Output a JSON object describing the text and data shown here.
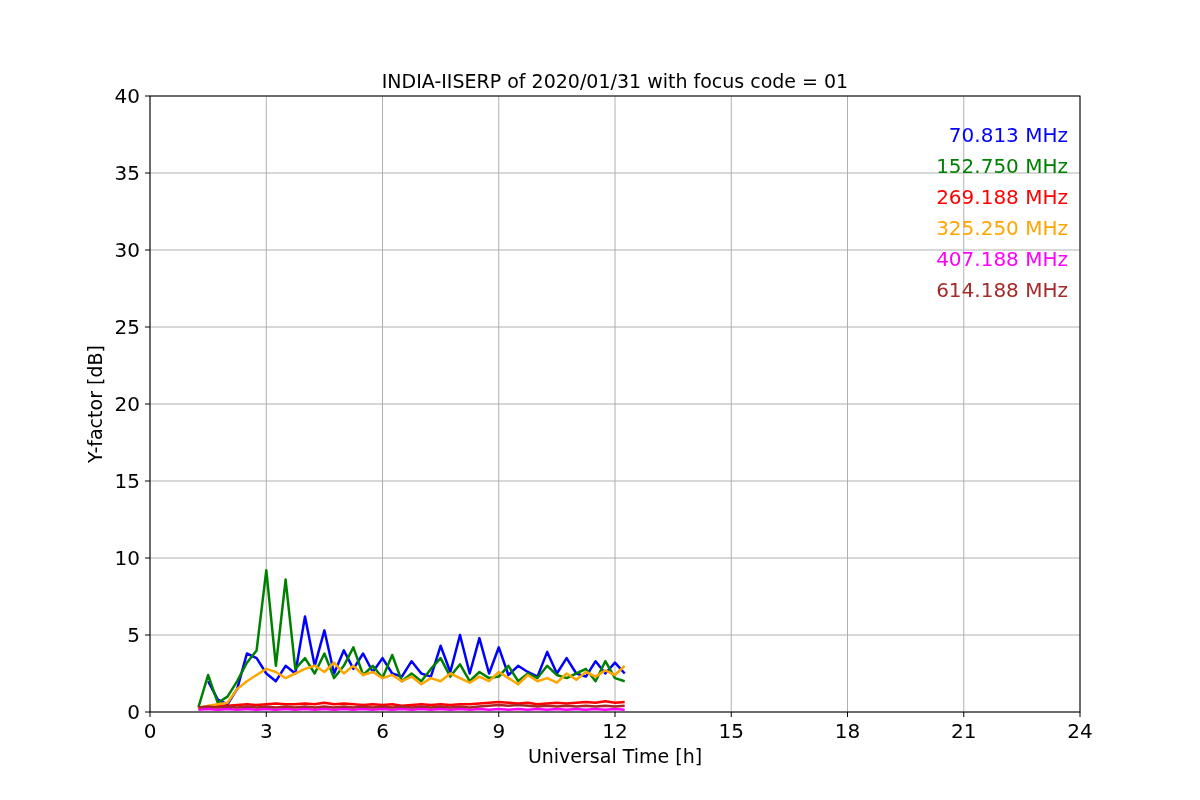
{
  "chart_data": {
    "type": "line",
    "title": "INDIA-IISERP of 2020/01/31 with focus code = 01",
    "xlabel": "Universal Time [h]",
    "ylabel": "Y-factor [dB]",
    "x": [
      1.25,
      1.5,
      1.75,
      2,
      2.25,
      2.5,
      2.75,
      3,
      3.25,
      3.5,
      3.75,
      4,
      4.25,
      4.5,
      4.75,
      5,
      5.25,
      5.5,
      5.75,
      6,
      6.25,
      6.5,
      6.75,
      7,
      7.25,
      7.5,
      7.75,
      8,
      8.25,
      8.5,
      8.75,
      9,
      9.25,
      9.5,
      9.75,
      10,
      10.25,
      10.5,
      10.75,
      11,
      11.25,
      11.5,
      11.75,
      12,
      12.25
    ],
    "grid": true,
    "xlim": [
      0,
      24
    ],
    "ylim": [
      0,
      40
    ],
    "xticks": [
      0,
      3,
      6,
      9,
      12,
      15,
      18,
      21,
      24
    ],
    "yticks": [
      0,
      5,
      10,
      15,
      20,
      25,
      30,
      35,
      40
    ],
    "series": [
      {
        "name": "70.813 MHz",
        "color": "#0000ff",
        "values": [
          null,
          2.0,
          0.8,
          0.5,
          1.5,
          3.8,
          3.5,
          2.5,
          2.0,
          3.0,
          2.5,
          6.2,
          3.0,
          5.3,
          2.5,
          4.0,
          2.8,
          3.8,
          2.6,
          3.5,
          2.5,
          2.3,
          3.3,
          2.5,
          2.3,
          4.3,
          2.6,
          5.0,
          2.5,
          4.8,
          2.5,
          4.2,
          2.4,
          3.0,
          2.6,
          2.3,
          3.9,
          2.5,
          3.5,
          2.5,
          2.3,
          3.3,
          2.5,
          3.2,
          2.5
        ]
      },
      {
        "name": "152.750 MHz",
        "color": "#008000",
        "values": [
          0.3,
          2.4,
          0.6,
          1.0,
          2.0,
          3.2,
          4.0,
          9.2,
          3.0,
          8.6,
          2.8,
          3.5,
          2.5,
          3.8,
          2.2,
          3.0,
          4.2,
          2.4,
          3.0,
          2.2,
          3.7,
          2.0,
          2.5,
          2.0,
          2.8,
          3.5,
          2.3,
          3.1,
          2.0,
          2.6,
          2.2,
          2.3,
          3.0,
          2.0,
          2.5,
          2.2,
          3.0,
          2.4,
          2.2,
          2.5,
          2.8,
          2.0,
          3.3,
          2.2,
          2.0
        ]
      },
      {
        "name": "269.188 MHz",
        "color": "#ff0000",
        "values": [
          0.3,
          0.35,
          0.4,
          0.4,
          0.45,
          0.5,
          0.45,
          0.5,
          0.55,
          0.5,
          0.5,
          0.55,
          0.5,
          0.6,
          0.5,
          0.55,
          0.5,
          0.45,
          0.5,
          0.45,
          0.5,
          0.4,
          0.45,
          0.5,
          0.45,
          0.5,
          0.45,
          0.5,
          0.5,
          0.55,
          0.6,
          0.65,
          0.6,
          0.55,
          0.6,
          0.5,
          0.55,
          0.6,
          0.55,
          0.6,
          0.65,
          0.6,
          0.7,
          0.6,
          0.65
        ]
      },
      {
        "name": "325.250 MHz",
        "color": "#ffa500",
        "values": [
          0.2,
          0.4,
          0.5,
          0.6,
          1.5,
          2.0,
          2.4,
          2.8,
          2.6,
          2.2,
          2.5,
          2.8,
          3.0,
          2.6,
          3.2,
          2.5,
          3.0,
          2.4,
          2.6,
          2.2,
          2.4,
          2.0,
          2.3,
          1.8,
          2.2,
          2.0,
          2.5,
          2.2,
          1.9,
          2.3,
          2.0,
          2.6,
          2.2,
          1.8,
          2.4,
          2.0,
          2.2,
          1.9,
          2.5,
          2.1,
          2.6,
          2.3,
          2.7,
          2.4,
          3.0
        ]
      },
      {
        "name": "407.188 MHz",
        "color": "#ff00ff",
        "values": [
          0.15,
          0.2,
          0.15,
          0.2,
          0.15,
          0.2,
          0.15,
          0.2,
          0.15,
          0.2,
          0.15,
          0.2,
          0.15,
          0.2,
          0.15,
          0.2,
          0.15,
          0.2,
          0.15,
          0.2,
          0.15,
          0.2,
          0.15,
          0.2,
          0.15,
          0.2,
          0.15,
          0.2,
          0.15,
          0.2,
          0.15,
          0.2,
          0.15,
          0.2,
          0.15,
          0.2,
          0.15,
          0.2,
          0.15,
          0.2,
          0.15,
          0.2,
          0.15,
          0.2,
          0.15
        ]
      },
      {
        "name": "614.188 MHz",
        "color": "#a52a2a",
        "values": [
          0.3,
          0.35,
          0.3,
          0.35,
          0.3,
          0.35,
          0.3,
          0.35,
          0.3,
          0.35,
          0.3,
          0.35,
          0.3,
          0.35,
          0.3,
          0.35,
          0.3,
          0.35,
          0.3,
          0.35,
          0.3,
          0.35,
          0.3,
          0.35,
          0.3,
          0.35,
          0.3,
          0.35,
          0.3,
          0.35,
          0.4,
          0.45,
          0.4,
          0.45,
          0.4,
          0.35,
          0.4,
          0.35,
          0.4,
          0.35,
          0.4,
          0.35,
          0.4,
          0.35,
          0.4
        ]
      }
    ]
  }
}
